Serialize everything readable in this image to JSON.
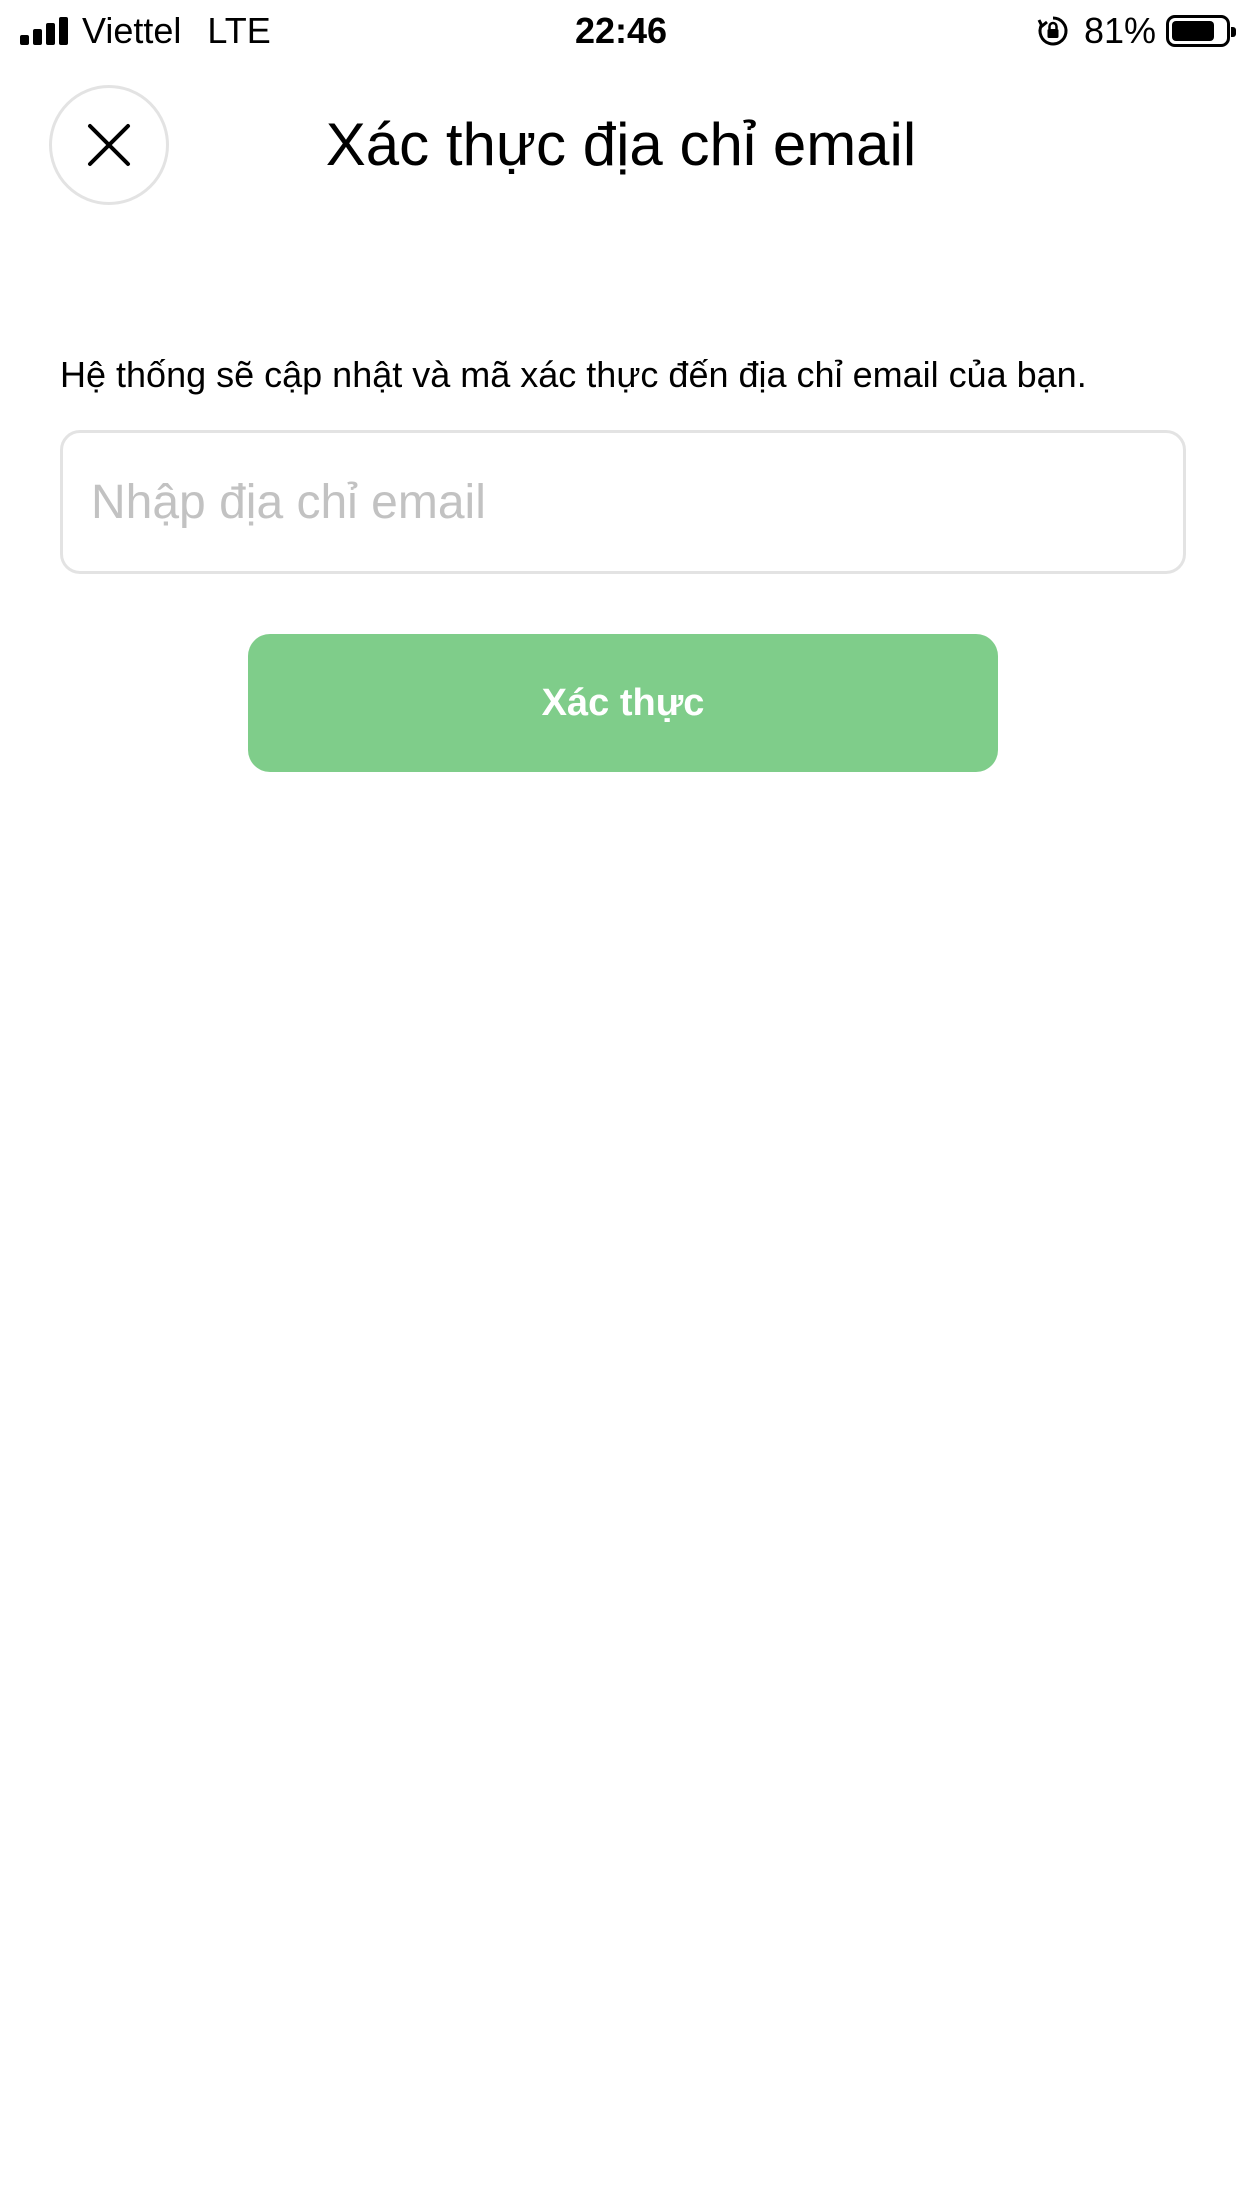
{
  "status_bar": {
    "carrier": "Viettel",
    "network": "LTE",
    "time": "22:46",
    "battery_percent": "81%",
    "battery_level": 0.81,
    "signal_bars": 4
  },
  "header": {
    "close_icon": "close-icon",
    "title": "Xác thực địa chỉ email"
  },
  "form": {
    "description": "Hệ thống sẽ cập nhật và mã xác thực đến địa chỉ email của bạn.",
    "email_placeholder": "Nhập địa chỉ email",
    "email_value": "",
    "submit_label": "Xác thực"
  },
  "colors": {
    "primary_button": "#7fcd8a",
    "input_border": "#e3e3e3",
    "placeholder": "#c2c2c2"
  }
}
